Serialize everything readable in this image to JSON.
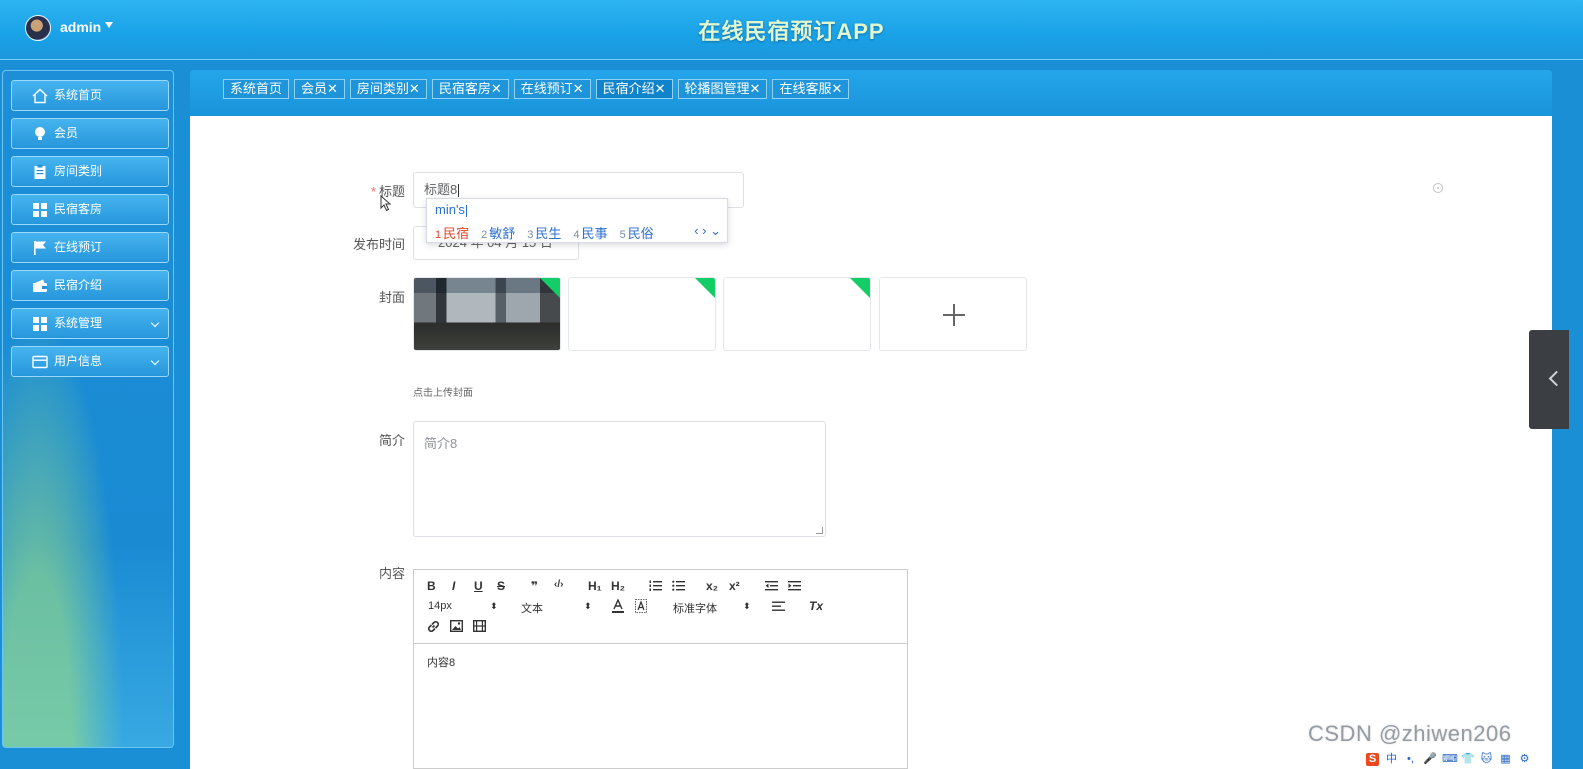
{
  "header": {
    "user_name": "admin",
    "app_title": "在线民宿预订APP"
  },
  "sidebar": {
    "items": [
      {
        "label": "系统首页",
        "icon": "home-icon"
      },
      {
        "label": "会员",
        "icon": "bulb-icon"
      },
      {
        "label": "房间类别",
        "icon": "clipboard-icon"
      },
      {
        "label": "民宿客房",
        "icon": "grid-icon"
      },
      {
        "label": "在线预订",
        "icon": "flag-icon"
      },
      {
        "label": "民宿介绍",
        "icon": "wallet-icon"
      },
      {
        "label": "系统管理",
        "icon": "grid-icon",
        "expandable": true
      },
      {
        "label": "用户信息",
        "icon": "card-icon",
        "expandable": true
      }
    ]
  },
  "tabs": [
    {
      "label": "系统首页"
    },
    {
      "label": "会员✕"
    },
    {
      "label": "房间类别✕"
    },
    {
      "label": "民宿客房✕"
    },
    {
      "label": "在线预订✕"
    },
    {
      "label": "民宿介绍✕",
      "active": true
    },
    {
      "label": "轮播图管理✕"
    },
    {
      "label": "在线客服✕"
    }
  ],
  "form": {
    "title_label": "标题",
    "title_required": "*",
    "title_value": "标题8",
    "date_label": "发布时间",
    "date_value": "2024 年 04 月 15 日",
    "cover_label": "封面",
    "cover_hint": "点击上传封面",
    "intro_label": "简介",
    "intro_value": "简介8",
    "content_label": "内容",
    "content_value": "内容8"
  },
  "ime": {
    "composition": "min's",
    "candidates": [
      {
        "num": "1",
        "text": "民宿"
      },
      {
        "num": "2",
        "text": "敏舒"
      },
      {
        "num": "3",
        "text": "民生"
      },
      {
        "num": "4",
        "text": "民事"
      },
      {
        "num": "5",
        "text": "民俗"
      }
    ],
    "nav": "‹ › ⌄"
  },
  "editor": {
    "buttons": {
      "bold": "B",
      "italic": "I",
      "underline": "U",
      "strike": "S",
      "quote": "❞",
      "code": "‹/›",
      "h1": "H₁",
      "h2": "H₂",
      "sub": "x₂",
      "sup": "x²",
      "clean": "Tx"
    },
    "size_value": "14px",
    "header_value": "文本",
    "font_value": "标准字体",
    "select_arrow": "⬍"
  },
  "watermark": "CSDN @zhiwen206",
  "ime_bar": [
    "S",
    "中",
    "•,",
    "🎤",
    "⌨",
    "👕",
    "🐱",
    "▦",
    "⚙"
  ],
  "colors": {
    "primary": "#1a8fd6",
    "accent_green": "#13ce66",
    "required": "#f56c6c",
    "ime_blue": "#2a6fcf",
    "ime_red": "#e0452a"
  }
}
